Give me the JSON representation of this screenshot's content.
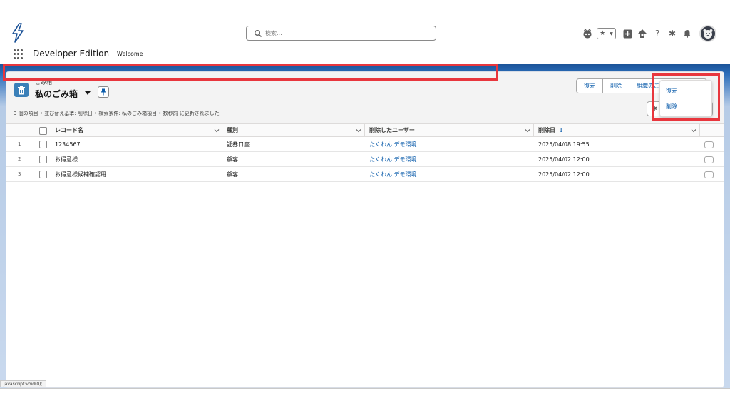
{
  "header": {
    "search_placeholder": "検索...",
    "app_name": "Developer Edition",
    "welcome": "Welcome"
  },
  "page": {
    "breadcrumb": "ごみ箱",
    "title": "私のごみ箱",
    "summary": "3 個の項目 • 並び替え基準: 削除日 • 検索条件: 私のごみ箱項目 • 数秒前 に更新されました",
    "buttons": {
      "restore": "復元",
      "delete": "削除",
      "empty_org": "組織のごみ箱を空にする"
    }
  },
  "table": {
    "columns": {
      "record_name": "レコード名",
      "type": "種別",
      "deleted_by": "削除したユーザー",
      "deleted_date": "削除日"
    },
    "rows": [
      {
        "num": "1",
        "name": "1234567",
        "type": "証券口座",
        "user": "たくわん デモ環境",
        "date": "2025/04/08 19:55"
      },
      {
        "num": "2",
        "name": "お得意様",
        "type": "顧客",
        "user": "たくわん デモ環境",
        "date": "2025/04/02 12:00"
      },
      {
        "num": "3",
        "name": "お得意様候補確認用",
        "type": "顧客",
        "user": "たくわん デモ環境",
        "date": "2025/04/02 12:00"
      }
    ]
  },
  "row_menu": {
    "restore": "復元",
    "delete": "削除"
  },
  "status_bar": "javascript:void(0);",
  "colors": {
    "brand_blue": "#1b5297",
    "link": "#0b5cab",
    "highlight": "#e8363d",
    "object_icon": "#3a7fb8"
  },
  "icons": {
    "logo": "lightning-bolt-icon",
    "search": "search-icon",
    "app_launcher": "waffle-icon",
    "trash": "trash-icon",
    "pin": "pin-icon",
    "settings": "gear-icon",
    "refresh": "refresh-icon",
    "chart": "chart-icon",
    "filter": "filter-icon"
  }
}
